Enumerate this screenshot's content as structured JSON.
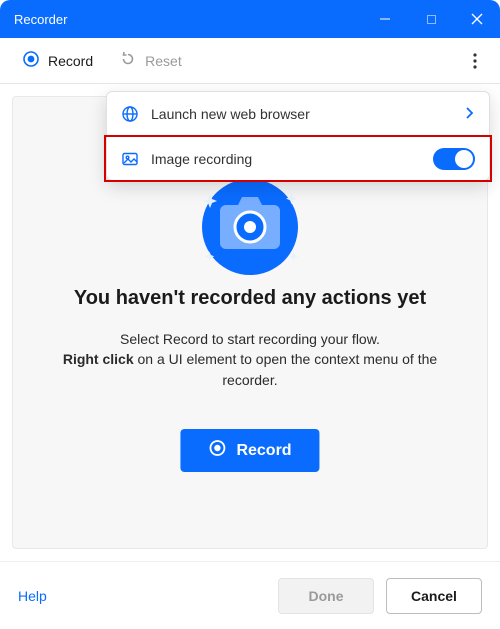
{
  "window": {
    "title": "Recorder"
  },
  "toolbar": {
    "record_label": "Record",
    "reset_label": "Reset"
  },
  "menu": {
    "launch_label": "Launch new web browser",
    "image_recording_label": "Image recording",
    "image_recording_on": true
  },
  "empty_state": {
    "headline": "You haven't recorded any actions yet",
    "sub_lead": "Select Record to start recording your flow.",
    "sub_strong": "Right click",
    "sub_tail": " on a UI element to open the context menu of the recorder.",
    "record_label": "Record"
  },
  "footer": {
    "help_label": "Help",
    "done_label": "Done",
    "cancel_label": "Cancel"
  }
}
